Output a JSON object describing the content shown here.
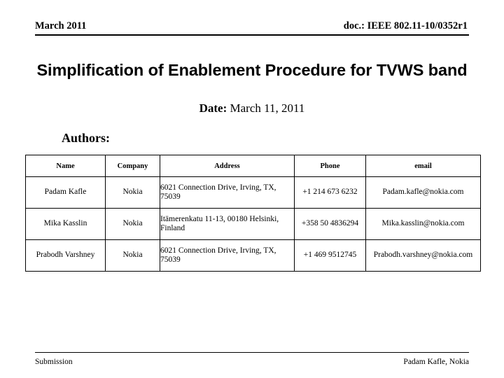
{
  "header": {
    "date": "March 2011",
    "doc": "doc.: IEEE 802.11-10/0352r1"
  },
  "title": "Simplification of Enablement Procedure for TVWS band",
  "date_line": {
    "label": "Date:",
    "value": " March 11, 2011"
  },
  "authors_heading": "Authors:",
  "authors_table": {
    "columns": [
      "Name",
      "Company",
      "Address",
      "Phone",
      "email"
    ],
    "rows": [
      {
        "name": "Padam Kafle",
        "company": "Nokia",
        "address": "6021 Connection Drive, Irving, TX, 75039",
        "phone": "+1 214 673 6232",
        "email": "Padam.kafle@nokia.com"
      },
      {
        "name": "Mika Kasslin",
        "company": "Nokia",
        "address": "Itämerenkatu 11-13, 00180 Helsinki, Finland",
        "phone": "+358 50 4836294",
        "email": "Mika.kasslin@nokia.com"
      },
      {
        "name": "Prabodh Varshney",
        "company": "Nokia",
        "address": "6021 Connection Drive, Irving, TX, 75039",
        "phone": "+1 469 9512745",
        "email": "Prabodh.varshney@nokia.com"
      }
    ]
  },
  "footer": {
    "left": "Submission",
    "right": "Padam Kafle, Nokia"
  },
  "colors": {
    "text": "#000000",
    "background": "#ffffff",
    "rule": "#000000"
  }
}
